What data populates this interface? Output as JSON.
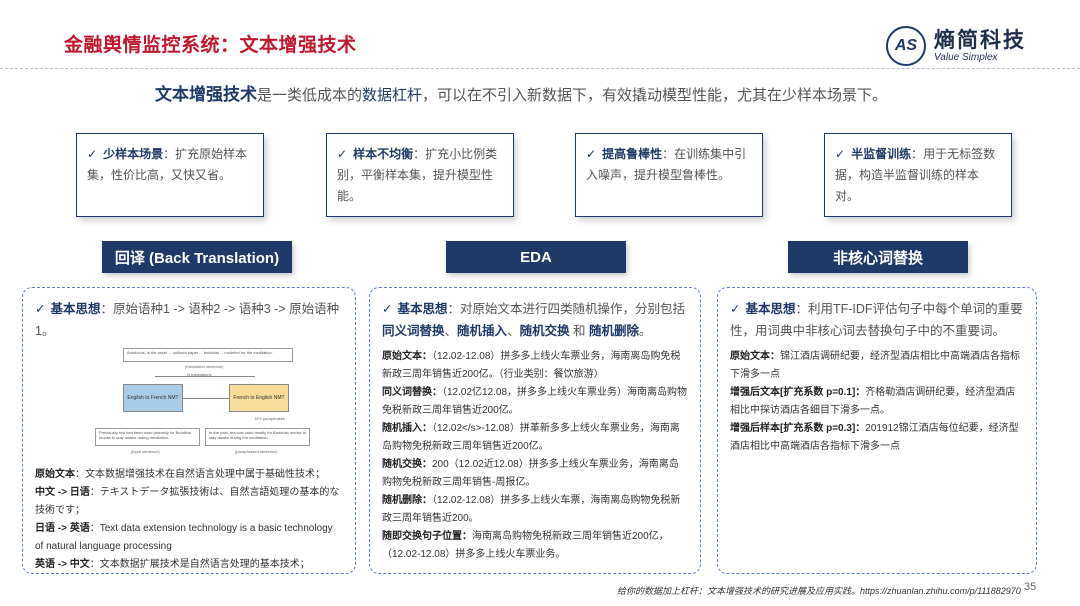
{
  "header": {
    "title": "金融舆情监控系统：文本增强技术",
    "logo_mark": "AS",
    "logo_cn": "熵简科技",
    "logo_en": "Value Simplex"
  },
  "intro": {
    "key": "文本增强技术",
    "text1": "是一类低成本的",
    "hl": "数据杠杆",
    "text2": "，可以在不引入新数据下，有效撬动模型性能，尤其在少样本场景下。"
  },
  "cards": [
    {
      "check": "✓",
      "title": "少样本场景",
      "text": "：扩充原始样本集，性价比高，又快又省。"
    },
    {
      "check": "✓",
      "title": "样本不均衡",
      "text": "：扩充小比例类别，平衡样本集，提升模型性能。"
    },
    {
      "check": "✓",
      "title": "提高鲁棒性",
      "text": "：在训练集中引入噪声，提升模型鲁棒性。"
    },
    {
      "check": "✓",
      "title": "半监督训练",
      "text": "：用于无标签数据，构造半监督训练的样本对。"
    }
  ],
  "methods": [
    "回译 (Back Translation)",
    "EDA",
    "非核心词替换"
  ],
  "bt": {
    "lead_title": "基本思想",
    "lead_text": "：原始语种1 -> 语种2 -> 语种3 -> 原始语种1。",
    "diagram": {
      "top_text": "Autofocus, is the asset ... outlined paper ... buddhist ... modeled for the meditation.",
      "top_label": "(translation sentence)",
      "mid_label": "N translations",
      "node1": "English to French NMT",
      "node2": "French to English NMT",
      "para_label": "N*3 paraphrases",
      "bl_text": "Previously, tea had been used primarily for Buddhist monks to stay awake during meditation.",
      "br_text": "In the past, tea was used mostly for Buddhist monks to stay awake during the meditation.",
      "bl_label": "(input sentence)",
      "br_label": "(paraphrased sentence)"
    },
    "lines": [
      {
        "label": "原始文本",
        "text": "：文本数据增强技术在自然语言处理中属于基础性技术；"
      },
      {
        "label": "中文 -> 日语",
        "text": "：テキストデータ拡張技術は、自然言語処理の基本的な技術です；"
      },
      {
        "label": "日语 -> 英语",
        "text": "：Text data extension technology is a basic technology of natural language processing"
      },
      {
        "label": "英语 -> 中文",
        "text": "：文本数据扩展技术是自然语言处理的基本技术；"
      }
    ]
  },
  "eda": {
    "lead_title": "基本思想",
    "lead_text1": "：对原始文本进行四类随机操作，分别包括",
    "ops": [
      "同义词替换",
      "随机插入",
      "随机交换",
      "随机删除"
    ],
    "sep1": "、",
    "sep2": "、",
    "sep3": " 和 ",
    "end": "。",
    "lines": [
      {
        "label": "原始文本：",
        "text": "（12.02-12.08）拼多多上线火车票业务，海南离岛购免税新政三周年销售近200亿。（行业类别：餐饮旅游）"
      },
      {
        "label": "同义词替换：",
        "text": "（12.02亿12.08，拼多多上线火车票业务）海南离岛购物免税新政三周年销售近200亿。"
      },
      {
        "label": "随机插入：",
        "text": "（12.02</s>-12.08）拼革新多多上线火车票业务，海南离岛购物免税新政三周年销售近200亿。"
      },
      {
        "label": "随机交换：",
        "text": "200（12.02近12.08）拼多多上线火车票业务，海南离岛购物免税新政三周年销售-周报亿。"
      },
      {
        "label": "随机删除：",
        "text": "（12.02-12.08）拼多多上线火车票，海南离岛购物免税新政三周年销售近200。"
      },
      {
        "label": "随即交换句子位置：",
        "text": "海南离岛购物免税新政三周年销售近200亿，（12.02-12.08）拼多多上线火车票业务。"
      }
    ]
  },
  "tfidf": {
    "lead_title": "基本思想",
    "lead_text": "：利用TF-IDF评估句子中每个单词的重要性，用词典中非核心词去替换句子中的不重要词。",
    "lines": [
      {
        "label": "原始文本：",
        "text": "锦江酒店调研纪要，经济型酒店相比中高端酒店各指标下滑多一点"
      },
      {
        "label": "增强后文本[扩充系数 p=0.1]：",
        "text": "齐格勒酒店调研纪要，经济型酒店相比中探访酒店各细目下滑多一点。"
      },
      {
        "label": "增强后样本[扩充系数 p=0.3]：",
        "text": "201912锦江酒店每位纪要，经济型酒店相比中高端酒店各指标下滑多一点"
      }
    ]
  },
  "footer": "给你的数据加上杠杆：文本增强技术的研究进展及应用实践。https://zhuanlan.zhihu.com/p/111882970",
  "page_number": "35",
  "colors": {
    "title_red": "#c0172c",
    "navy": "#1f3a68",
    "dash_blue": "#5b7fc2"
  }
}
